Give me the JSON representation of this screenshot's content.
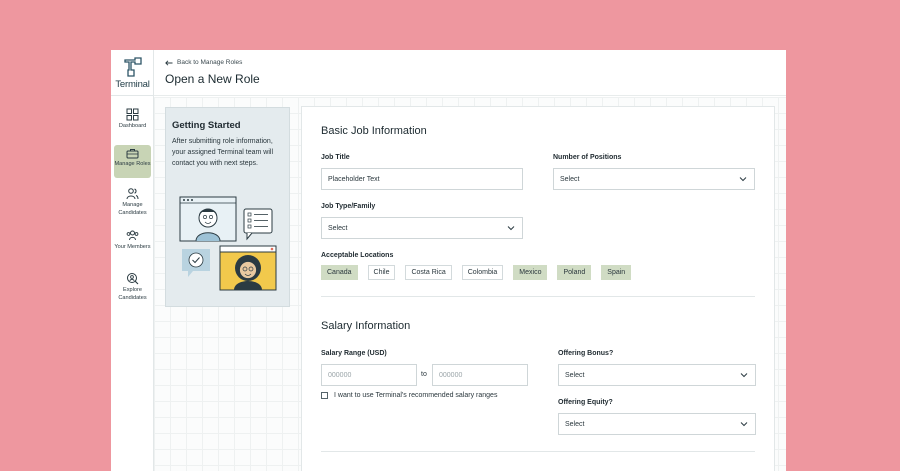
{
  "sidebar": {
    "brand": "Terminal",
    "items": [
      {
        "label": "Dashboard",
        "icon": "grid-icon"
      },
      {
        "label": "Manage Roles",
        "icon": "briefcase-icon",
        "active": true
      },
      {
        "label": "Manage Candidates",
        "icon": "users-icon"
      },
      {
        "label": "Your Members",
        "icon": "team-icon"
      },
      {
        "label": "Explore Candidates",
        "icon": "search-person-icon"
      }
    ]
  },
  "header": {
    "back_label": "Back to Manage Roles",
    "title": "Open a New Role"
  },
  "getting_started": {
    "title": "Getting Started",
    "text": "After submitting role information, your assigned Terminal team will contact you with next steps."
  },
  "form": {
    "basic": {
      "title": "Basic Job Information",
      "job_title_label": "Job Title",
      "job_title_value": "Placeholder Text",
      "positions_label": "Number of Positions",
      "positions_value": "Select",
      "type_label": "Job Type/Family",
      "type_value": "Select",
      "locations_label": "Acceptable Locations",
      "locations": [
        {
          "name": "Canada",
          "selected": true
        },
        {
          "name": "Chile",
          "selected": false
        },
        {
          "name": "Costa Rica",
          "selected": false
        },
        {
          "name": "Colombia",
          "selected": false
        },
        {
          "name": "Mexico",
          "selected": true
        },
        {
          "name": "Poland",
          "selected": true
        },
        {
          "name": "Spain",
          "selected": true
        }
      ]
    },
    "salary": {
      "title": "Salary Information",
      "range_label": "Salary Range (USD)",
      "min_placeholder": "000000",
      "to_label": "to",
      "max_placeholder": "000000",
      "checkbox_label": "I want to use Terminal's recommended salary ranges",
      "checkbox_checked": false,
      "bonus_label": "Offering Bonus?",
      "bonus_value": "Select",
      "equity_label": "Offering Equity?",
      "equity_value": "Select"
    }
  },
  "colors": {
    "background": "#ee979f",
    "active_nav": "#c8d4b5",
    "chip_selected": "#d0dcc4",
    "illustration_yellow": "#f2c94c"
  }
}
